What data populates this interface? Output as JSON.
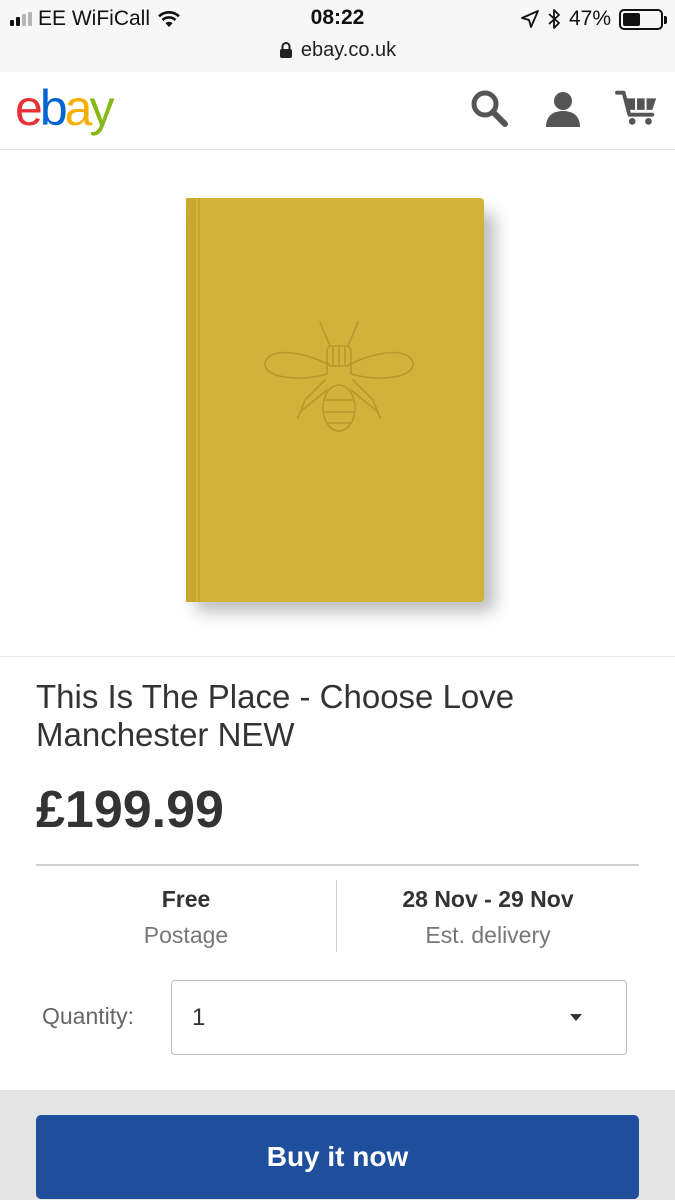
{
  "status_bar": {
    "carrier": "EE WiFiCall",
    "time": "08:22",
    "battery": "47%",
    "battery_level": 0.47,
    "url": "ebay.co.uk",
    "icons": [
      "signal-icon",
      "wifi-icon",
      "location-arrow-icon",
      "bluetooth-icon",
      "battery-icon",
      "lock-icon"
    ]
  },
  "header": {
    "logo": {
      "e": "e",
      "b": "b",
      "a": "a",
      "y": "y"
    },
    "logo_colors": {
      "e": "#e53238",
      "b": "#0064d2",
      "a": "#f5af02",
      "y": "#86b817"
    },
    "icons": [
      "search-icon",
      "user-icon",
      "cart-icon"
    ]
  },
  "product": {
    "image": "yellow-notebook-bee-emboss",
    "title": "This Is The Place - Choose Love Manchester NEW",
    "price": "£199.99"
  },
  "shipping": {
    "postage_value": "Free",
    "postage_label": "Postage",
    "delivery_value": "28 Nov - 29 Nov",
    "delivery_label": "Est. delivery"
  },
  "quantity": {
    "label": "Quantity:",
    "value": "1"
  },
  "actions": {
    "buy_now": "Buy it now",
    "buy_now_color": "#1f4f9c"
  }
}
